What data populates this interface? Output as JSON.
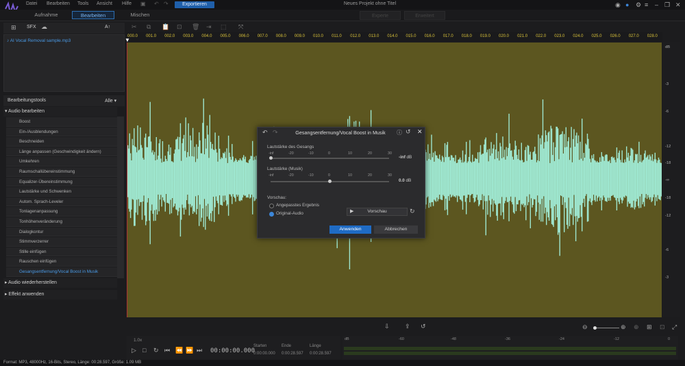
{
  "menu": {
    "items": [
      "Datei",
      "Bearbeiten",
      "Tools",
      "Ansicht",
      "Hilfe"
    ],
    "export_label": "Exportieren"
  },
  "window": {
    "title": "Neues Projekt ohne Titel"
  },
  "mode_tabs": {
    "aufnahme": "Aufnahme",
    "bearbeiten": "Bearbeiten",
    "mischen": "Mischen"
  },
  "view_tabs": {
    "expert": "Experte",
    "extended": "Erweitert"
  },
  "media": {
    "sfx_label": "SFX",
    "sort_label": "A↑",
    "file": "AI Vocal Removal sample.mp3"
  },
  "tools": {
    "header": "Bearbeitungstools",
    "filter": "Alle",
    "group_audio_edit": "Audio bearbeiten",
    "items": [
      "Boost",
      "Ein-/Ausblendungen",
      "Beschneiden",
      "Länge anpassen (Geschwindigkeit ändern)",
      "Umkehren",
      "Raumschallübereinstimmung",
      "Equalizer-Übereinstimmung",
      "Lautstärke und Schwenken",
      "Autom. Sprach-Leveler",
      "Tonlagenanpassung",
      "Tonhöhenveränderung",
      "Dialogkontur",
      "Stimmverzerrer",
      "Stille einfügen",
      "Rauschen einfügen",
      "Gesangsentfernung/Vocal Boost in Musik"
    ],
    "group_restore": "Audio wiederherstellen",
    "group_effect": "Effekt anwenden"
  },
  "ruler": {
    "ticks": [
      "000.0",
      "001.0",
      "002.0",
      "003.0",
      "004.0",
      "005.0",
      "006.0",
      "007.0",
      "008.0",
      "009.0",
      "010.0",
      "011.0",
      "012.0",
      "013.0",
      "014.0",
      "015.0",
      "016.0",
      "017.0",
      "018.0",
      "019.0",
      "020.0",
      "021.0",
      "022.0",
      "023.0",
      "024.0",
      "025.0",
      "026.0",
      "027.0",
      "028.0"
    ]
  },
  "db_scale": [
    "dB",
    "-3",
    "-6",
    "-12",
    "-18",
    "-∞",
    "-18",
    "-12",
    "-6",
    "-3"
  ],
  "dialog": {
    "title": "Gesangsentfernung/Vocal Boost in Musik",
    "vocal_label": "Lautstärke des Gesangs",
    "vocal_value": "-inf",
    "music_label": "Lautstärke (Musik)",
    "music_value": "0.0",
    "unit": "dB",
    "scale": [
      "-inf",
      "-20",
      "-10",
      "0",
      "10",
      "20",
      "30"
    ],
    "preview_label": "Vorschau:",
    "radio_custom": "Angepasstes Ergebnis",
    "radio_original": "Original-Audio",
    "preview_button": "Vorschau",
    "apply": "Anwenden",
    "cancel": "Abbrechen"
  },
  "transport": {
    "speed": "1.0x",
    "timecode": "00:00:00.000",
    "start_label": "Starten",
    "start": "0:00:00.000",
    "end_label": "Ende",
    "end": "0:00:28.597",
    "length_label": "Länge",
    "length": "0:00:28.597"
  },
  "meter_labels": [
    "dB",
    "-60",
    "-48",
    "-36",
    "-24",
    "-12",
    "0"
  ],
  "status": "Format: MP3, 48000Hz, 16-Bits, Stereo, Länge: 00:28.597, Größe: 1.09 MB",
  "colors": {
    "waveform": "#9ee6cf",
    "wave_bg": "#5c5620",
    "accent": "#1f6bc4",
    "ruler_text": "#d9c23a"
  }
}
